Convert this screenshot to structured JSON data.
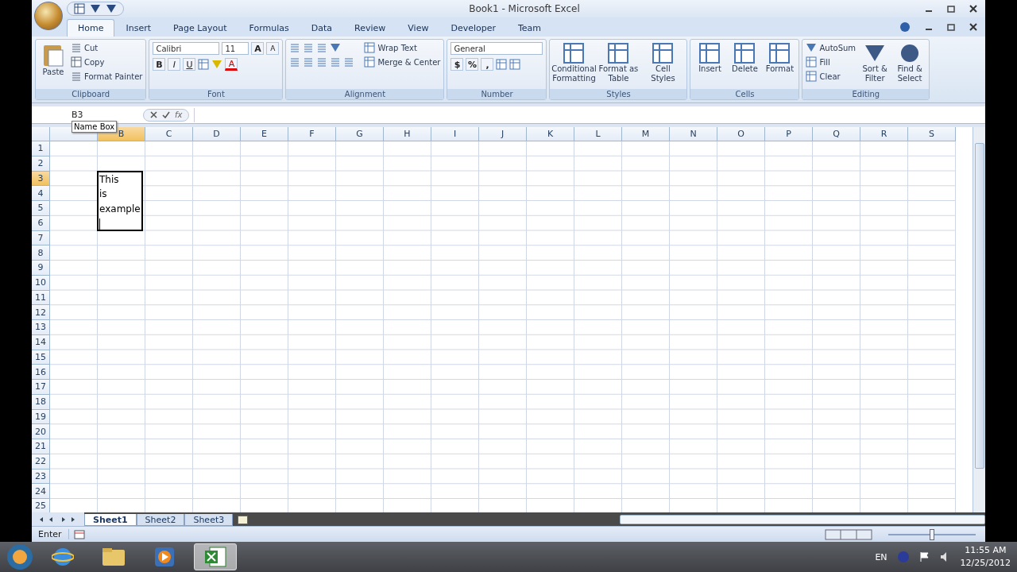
{
  "window": {
    "title": "Book1 - Microsoft Excel"
  },
  "tabs": [
    {
      "label": "Home",
      "selected": true
    },
    {
      "label": "Insert",
      "selected": false
    },
    {
      "label": "Page Layout",
      "selected": false
    },
    {
      "label": "Formulas",
      "selected": false
    },
    {
      "label": "Data",
      "selected": false
    },
    {
      "label": "Review",
      "selected": false
    },
    {
      "label": "View",
      "selected": false
    },
    {
      "label": "Developer",
      "selected": false
    },
    {
      "label": "Team",
      "selected": false
    }
  ],
  "ribbon": {
    "groups": [
      {
        "kind": "clipboard",
        "label": "Clipboard",
        "items": [
          {
            "label": "Paste"
          },
          {
            "label": "Cut"
          },
          {
            "label": "Copy"
          },
          {
            "label": "Format Painter"
          }
        ]
      },
      {
        "kind": "font",
        "label": "Font",
        "font": "Calibri",
        "size": "11",
        "grow": "A",
        "shrink": "A",
        "bold": "B",
        "italic": "I",
        "underline": "U",
        "font_color_label": "A"
      },
      {
        "kind": "alignment",
        "label": "Alignment",
        "items": [
          {
            "label": "Wrap Text"
          },
          {
            "label": "Merge & Center"
          }
        ]
      },
      {
        "kind": "number",
        "label": "Number",
        "format": "General",
        "symbols": [
          "$",
          "%",
          ","
        ]
      },
      {
        "kind": "large",
        "label": "Styles",
        "items": [
          {
            "label": "Conditional Formatting"
          },
          {
            "label": "Format as Table"
          },
          {
            "label": "Cell Styles"
          }
        ]
      },
      {
        "kind": "large",
        "label": "Cells",
        "items": [
          {
            "label": "Insert"
          },
          {
            "label": "Delete"
          },
          {
            "label": "Format"
          }
        ]
      },
      {
        "kind": "editing",
        "label": "Editing",
        "small": [
          {
            "label": "AutoSum"
          },
          {
            "label": "Fill"
          },
          {
            "label": "Clear"
          }
        ],
        "items": [
          {
            "label": "Sort & Filter"
          },
          {
            "label": "Find & Select"
          }
        ]
      }
    ]
  },
  "formula_bar": {
    "name_box": "B3",
    "tooltip": "Name Box",
    "fx": "fx"
  },
  "sheet": {
    "columns": [
      {
        "selected": false
      },
      {
        "label": "B",
        "selected": true
      },
      {
        "label": "C",
        "selected": false
      },
      {
        "label": "D",
        "selected": false
      },
      {
        "label": "E",
        "selected": false
      },
      {
        "label": "F",
        "selected": false
      },
      {
        "label": "G",
        "selected": false
      },
      {
        "label": "H",
        "selected": false
      },
      {
        "label": "I",
        "selected": false
      },
      {
        "label": "J",
        "selected": false
      },
      {
        "label": "K",
        "selected": false
      },
      {
        "label": "L",
        "selected": false
      },
      {
        "label": "M",
        "selected": false
      },
      {
        "label": "N",
        "selected": false
      },
      {
        "label": "O",
        "selected": false
      },
      {
        "label": "P",
        "selected": false
      },
      {
        "label": "Q",
        "selected": false
      },
      {
        "label": "R",
        "selected": false
      },
      {
        "label": "S",
        "selected": false
      }
    ],
    "rows": [
      {
        "label": "1",
        "selected": false
      },
      {
        "label": "2",
        "selected": false
      },
      {
        "label": "3",
        "selected": true
      },
      {
        "label": "4",
        "selected": false
      },
      {
        "label": "5",
        "selected": false
      },
      {
        "label": "6",
        "selected": false
      },
      {
        "label": "7",
        "selected": false
      },
      {
        "label": "8",
        "selected": false
      },
      {
        "label": "9",
        "selected": false
      },
      {
        "label": "10",
        "selected": false
      },
      {
        "label": "11",
        "selected": false
      },
      {
        "label": "12",
        "selected": false
      },
      {
        "label": "13",
        "selected": false
      },
      {
        "label": "14",
        "selected": false
      },
      {
        "label": "15",
        "selected": false
      },
      {
        "label": "16",
        "selected": false
      },
      {
        "label": "17",
        "selected": false
      },
      {
        "label": "18",
        "selected": false
      },
      {
        "label": "19",
        "selected": false
      },
      {
        "label": "20",
        "selected": false
      },
      {
        "label": "21",
        "selected": false
      },
      {
        "label": "22",
        "selected": false
      },
      {
        "label": "23",
        "selected": false
      },
      {
        "label": "24",
        "selected": false
      },
      {
        "label": "25",
        "selected": false
      }
    ],
    "edit_cell": {
      "lines": [
        "This",
        "is",
        "example"
      ]
    }
  },
  "sheet_tabs": [
    {
      "label": "Sheet1",
      "selected": true
    },
    {
      "label": "Sheet2",
      "selected": false
    },
    {
      "label": "Sheet3",
      "selected": false
    }
  ],
  "status_bar": {
    "mode": "Enter",
    "zoom_slider": {
      "level": 0.5
    }
  },
  "taskbar": {
    "apps": [
      {
        "kind": "browser",
        "selected": false
      },
      {
        "kind": "folder",
        "selected": false
      },
      {
        "kind": "media",
        "selected": false
      },
      {
        "kind": "excel",
        "selected": true
      }
    ],
    "language": "EN",
    "time": "11:55 AM",
    "date": "12/25/2012"
  }
}
